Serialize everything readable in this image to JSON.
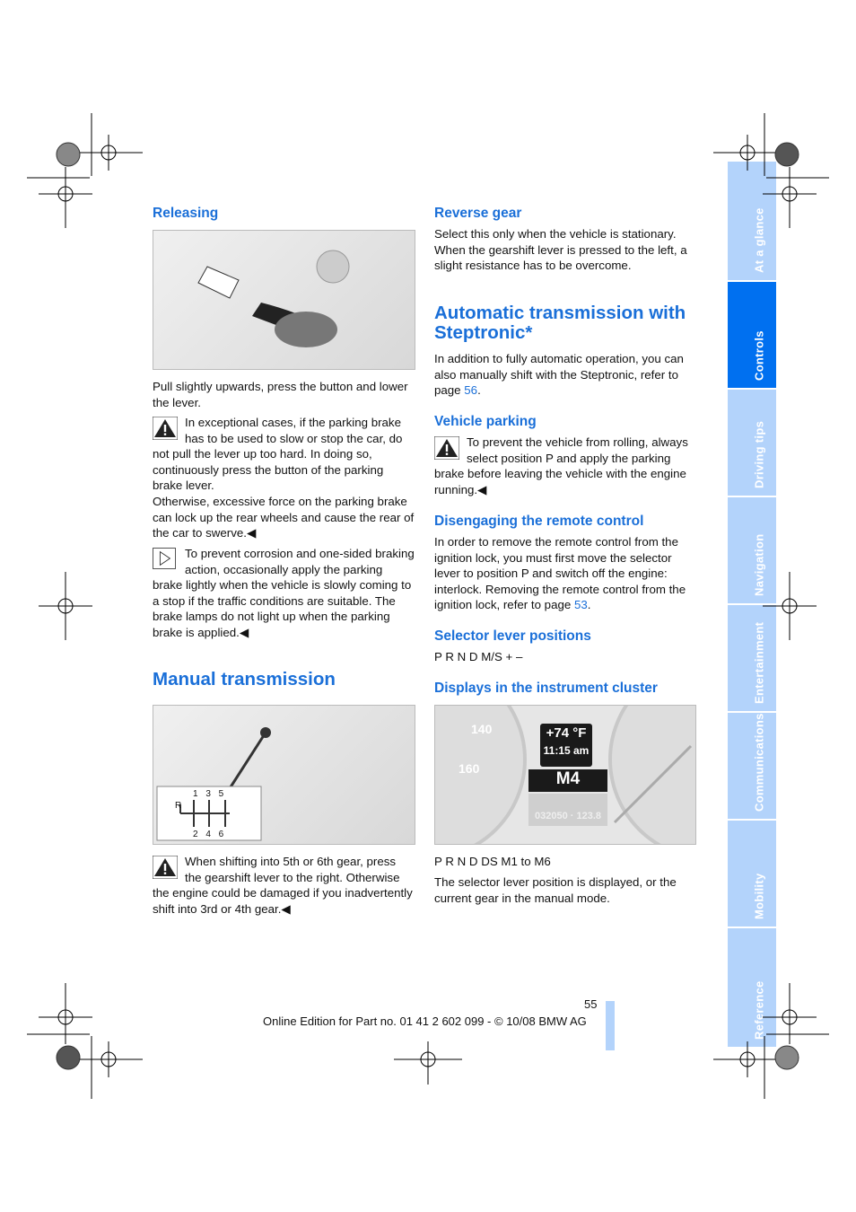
{
  "left": {
    "releasing": {
      "title": "Releasing",
      "text": "Pull slightly upwards, press the button and lower the lever."
    },
    "warning1": {
      "p1": "In exceptional cases, if the parking brake has to be used to slow or stop the car, do not pull the lever up too hard. In doing so, continuously press the button of the parking brake lever.",
      "p2": "Otherwise, excessive force on the parking brake can lock up the rear wheels and cause the rear of the car to swerve.◀"
    },
    "note1": "To prevent corrosion and one-sided braking action, occasionally apply the parking brake lightly when the vehicle is slowly coming to a stop if the traffic conditions are suitable. The brake lamps do not light up when the parking brake is applied.◀",
    "manual": {
      "title": "Manual transmission",
      "gears_top": "1  3  5",
      "gears_bottom": "2  4  6",
      "gear_r": "R"
    },
    "warning2": "When shifting into 5th or 6th gear, press the gearshift lever to the right. Otherwise the engine could be damaged if you inadvertently shift into 3rd or 4th gear.◀"
  },
  "right": {
    "reverse": {
      "title": "Reverse gear",
      "text": "Select this only when the vehicle is stationary. When the gearshift lever is pressed to the left, a slight resistance has to be overcome."
    },
    "auto": {
      "title": "Automatic transmission with Steptronic*",
      "text": "In addition to fully automatic operation, you can also manually shift with the Steptronic, refer to page ",
      "page": "56"
    },
    "parking": {
      "title": "Vehicle parking",
      "text": "To prevent the vehicle from rolling, always select position P and apply the parking brake before leaving the vehicle with the engine running.◀"
    },
    "disengage": {
      "title": "Disengaging the remote control",
      "text": "In order to remove the remote control from the ignition lock, you must first move the selector lever to position P and switch off the engine: interlock. Removing the remote control from the ignition lock, refer to page ",
      "page": "53"
    },
    "selector": {
      "title": "Selector lever positions",
      "text": "P R N D M/S + –"
    },
    "displays": {
      "title": "Displays in the instrument cluster",
      "temp": "+74 °F",
      "time": "11:15 am",
      "gear": "M4",
      "odo": "032050 · 123.8",
      "speed1": "140",
      "speed2": "160",
      "text1": "P R N D DS M1 to M6",
      "text2": "The selector lever position is displayed, or the current gear in the manual mode."
    }
  },
  "footer": {
    "page_number": "55",
    "edition": "Online Edition for Part no. 01 41 2 602 099 - © 10/08 BMW AG"
  },
  "tabs": [
    {
      "label": "At a glance"
    },
    {
      "label": "Controls",
      "active": true
    },
    {
      "label": "Driving tips"
    },
    {
      "label": "Navigation"
    },
    {
      "label": "Entertainment"
    },
    {
      "label": "Communications"
    },
    {
      "label": "Mobility"
    },
    {
      "label": "Reference"
    }
  ],
  "colors": {
    "accent": "#1a6fd8",
    "tab_active": "#0070f0",
    "tab": "#b3d3fb"
  }
}
